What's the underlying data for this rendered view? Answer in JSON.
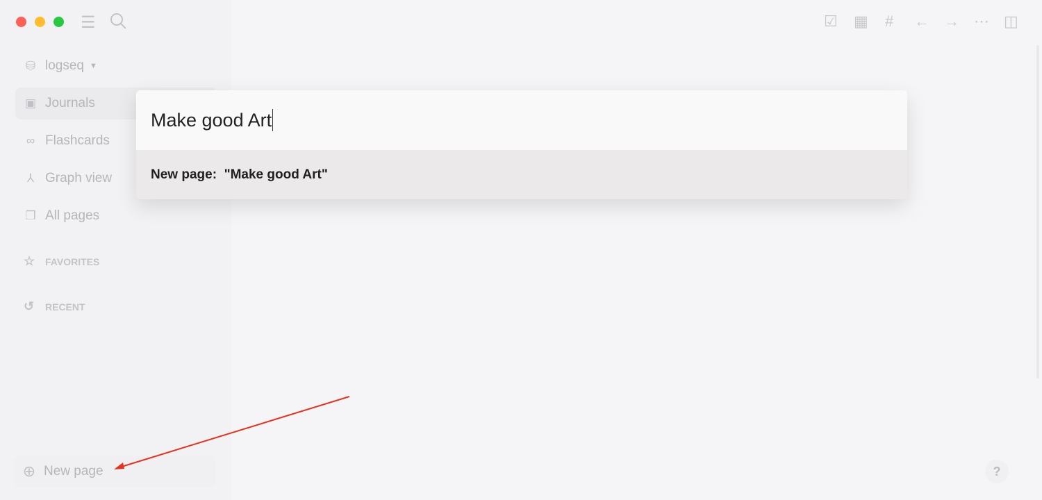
{
  "window": {
    "controls": {
      "close": "#fe5f57",
      "minimize": "#febc2e",
      "maximize": "#28c840"
    }
  },
  "sidebar": {
    "repo": "logseq",
    "items": [
      {
        "label": "Journals",
        "icon": "calendar-icon"
      },
      {
        "label": "Flashcards",
        "icon": "infinity-icon"
      },
      {
        "label": "Graph view",
        "icon": "graph-icon"
      },
      {
        "label": "All pages",
        "icon": "pages-icon"
      }
    ],
    "favorites": "FAVORITES",
    "recent": "RECENT",
    "new_page": "New page"
  },
  "search": {
    "value": "Make good Art",
    "result": "New page:  \"Make good Art\""
  },
  "help": "?"
}
